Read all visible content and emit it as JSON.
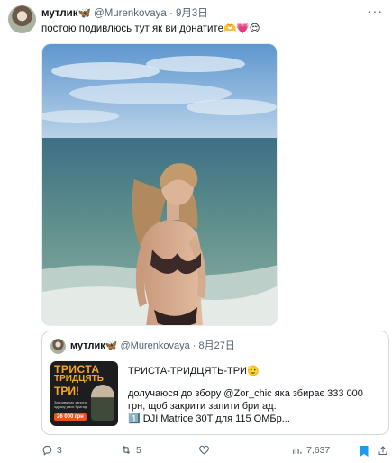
{
  "author": {
    "name": "мутлик🦋",
    "handle": "@Murenkovaya",
    "date": "9月3日"
  },
  "tweet_text": "постою подивлюсь тут як ви донатите🫶💗😌",
  "menu_icon": "more-horizontal-icon",
  "quote": {
    "name": "мутлик🦋",
    "handle": "@Murenkovaya",
    "date": "8月27日",
    "title": "ТРИСТА-ТРИДЦЯТЬ-ТРИ🫡",
    "lines": [
      "долучаюся до збору @Zor_chic яка збирає 333 000",
      "грн, щоб закрити запити бригад:",
      "1️⃣ DJI Matrice 30T для 115 ОМБр..."
    ],
    "thumbnail": {
      "title_1": "ТРИСТА",
      "title_2": "ТРИДЦЯТЬ",
      "title_3": "ТРИ!",
      "subtitle": "Закриваємо запити одразу двох бригад!",
      "amount": "26 000 грн"
    }
  },
  "actions": {
    "replies": "3",
    "retweets": "5",
    "views": "7,637"
  },
  "colors": {
    "text": "#0f1419",
    "muted": "#536471",
    "bookmark_active": "#1d9bf0",
    "border": "#cfd9de"
  }
}
